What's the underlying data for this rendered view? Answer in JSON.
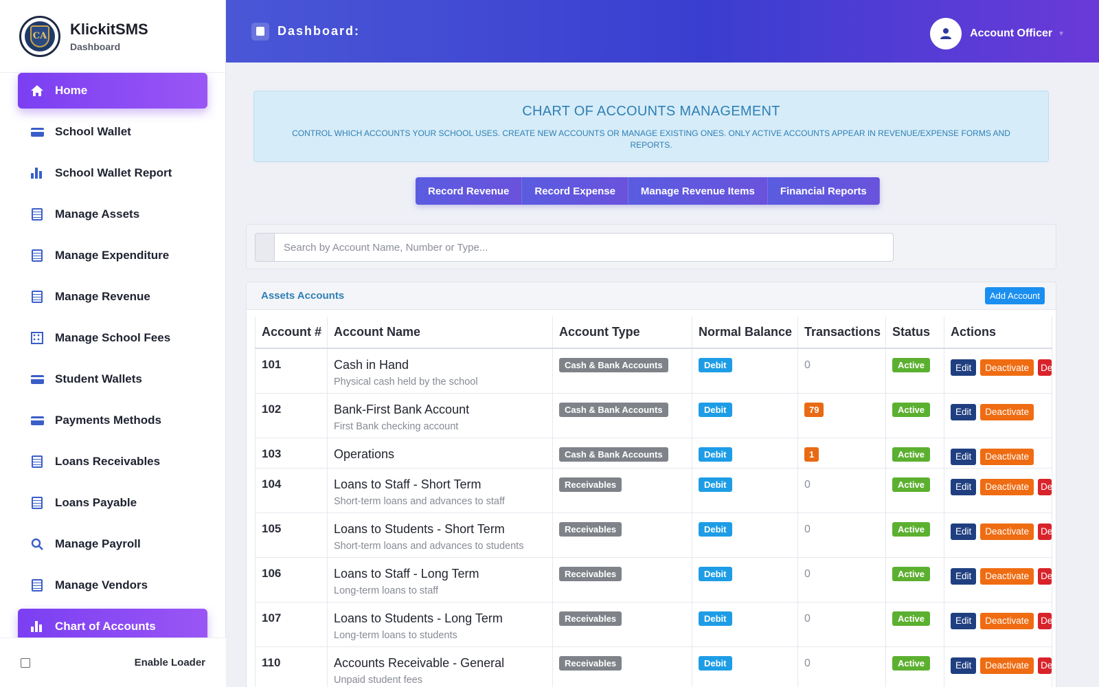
{
  "brand": {
    "name": "KlickitSMS",
    "subtitle": "Dashboard",
    "logo_text": "CA"
  },
  "sidebar": {
    "items": [
      {
        "label": "Home",
        "icon": "home-icon",
        "active": true
      },
      {
        "label": "School Wallet",
        "icon": "card-icon",
        "active": false
      },
      {
        "label": "School Wallet Report",
        "icon": "bar-chart-icon",
        "active": false
      },
      {
        "label": "Manage Assets",
        "icon": "list-icon",
        "active": false
      },
      {
        "label": "Manage Expenditure",
        "icon": "list-icon",
        "active": false
      },
      {
        "label": "Manage Revenue",
        "icon": "list-icon",
        "active": false
      },
      {
        "label": "Manage School Fees",
        "icon": "qr-code-icon",
        "active": false
      },
      {
        "label": "Student Wallets",
        "icon": "card-icon",
        "active": false
      },
      {
        "label": "Payments Methods",
        "icon": "card-icon",
        "active": false
      },
      {
        "label": "Loans Receivables",
        "icon": "list-icon",
        "active": false
      },
      {
        "label": "Loans Payable",
        "icon": "list-icon",
        "active": false
      },
      {
        "label": "Manage Payroll",
        "icon": "search-icon",
        "active": false
      },
      {
        "label": "Manage Vendors",
        "icon": "list-icon",
        "active": false
      },
      {
        "label": "Chart of Accounts",
        "icon": "bar-chart-icon",
        "active": true
      }
    ],
    "loader_label": "Enable Loader"
  },
  "header": {
    "title": "Dashboard:",
    "account_name": "Account Officer"
  },
  "banner": {
    "title": "CHART OF ACCOUNTS MANAGEMENT",
    "subtitle": "CONTROL WHICH ACCOUNTS YOUR SCHOOL USES. CREATE NEW ACCOUNTS OR MANAGE EXISTING ONES. ONLY ACTIVE ACCOUNTS APPEAR IN REVENUE/EXPENSE FORMS AND REPORTS."
  },
  "tabs": [
    "Record Revenue",
    "Record Expense",
    "Manage Revenue Items",
    "Financial Reports"
  ],
  "search": {
    "placeholder": "Search by Account Name, Number or Type..."
  },
  "card": {
    "title": "Assets Accounts",
    "add_label": "Add Account"
  },
  "table": {
    "columns": [
      "Account #",
      "Account Name",
      "Account Type",
      "Normal Balance",
      "Transactions",
      "Status",
      "Actions"
    ],
    "actions": {
      "edit": "Edit",
      "deactivate": "Deactivate",
      "delete": "Delete"
    },
    "rows": [
      {
        "number": "101",
        "name": "Cash in Hand",
        "desc": "Physical cash held by the school",
        "type": "Cash & Bank Accounts",
        "balance": "Debit",
        "transactions": "0",
        "status": "Active",
        "deletable": true
      },
      {
        "number": "102",
        "name": "Bank-First Bank Account",
        "desc": "First Bank checking account",
        "type": "Cash & Bank Accounts",
        "balance": "Debit",
        "transactions": "79",
        "status": "Active",
        "deletable": false
      },
      {
        "number": "103",
        "name": "Operations",
        "desc": "",
        "type": "Cash & Bank Accounts",
        "balance": "Debit",
        "transactions": "1",
        "status": "Active",
        "deletable": false
      },
      {
        "number": "104",
        "name": "Loans to Staff - Short Term",
        "desc": "Short-term loans and advances to staff",
        "type": "Receivables",
        "balance": "Debit",
        "transactions": "0",
        "status": "Active",
        "deletable": true
      },
      {
        "number": "105",
        "name": "Loans to Students - Short Term",
        "desc": "Short-term loans and advances to students",
        "type": "Receivables",
        "balance": "Debit",
        "transactions": "0",
        "status": "Active",
        "deletable": true
      },
      {
        "number": "106",
        "name": "Loans to Staff - Long Term",
        "desc": "Long-term loans to staff",
        "type": "Receivables",
        "balance": "Debit",
        "transactions": "0",
        "status": "Active",
        "deletable": true
      },
      {
        "number": "107",
        "name": "Loans to Students - Long Term",
        "desc": "Long-term loans to students",
        "type": "Receivables",
        "balance": "Debit",
        "transactions": "0",
        "status": "Active",
        "deletable": true
      },
      {
        "number": "110",
        "name": "Accounts Receivable - General",
        "desc": "Unpaid student fees",
        "type": "Receivables",
        "balance": "Debit",
        "transactions": "0",
        "status": "Active",
        "deletable": true
      }
    ]
  }
}
